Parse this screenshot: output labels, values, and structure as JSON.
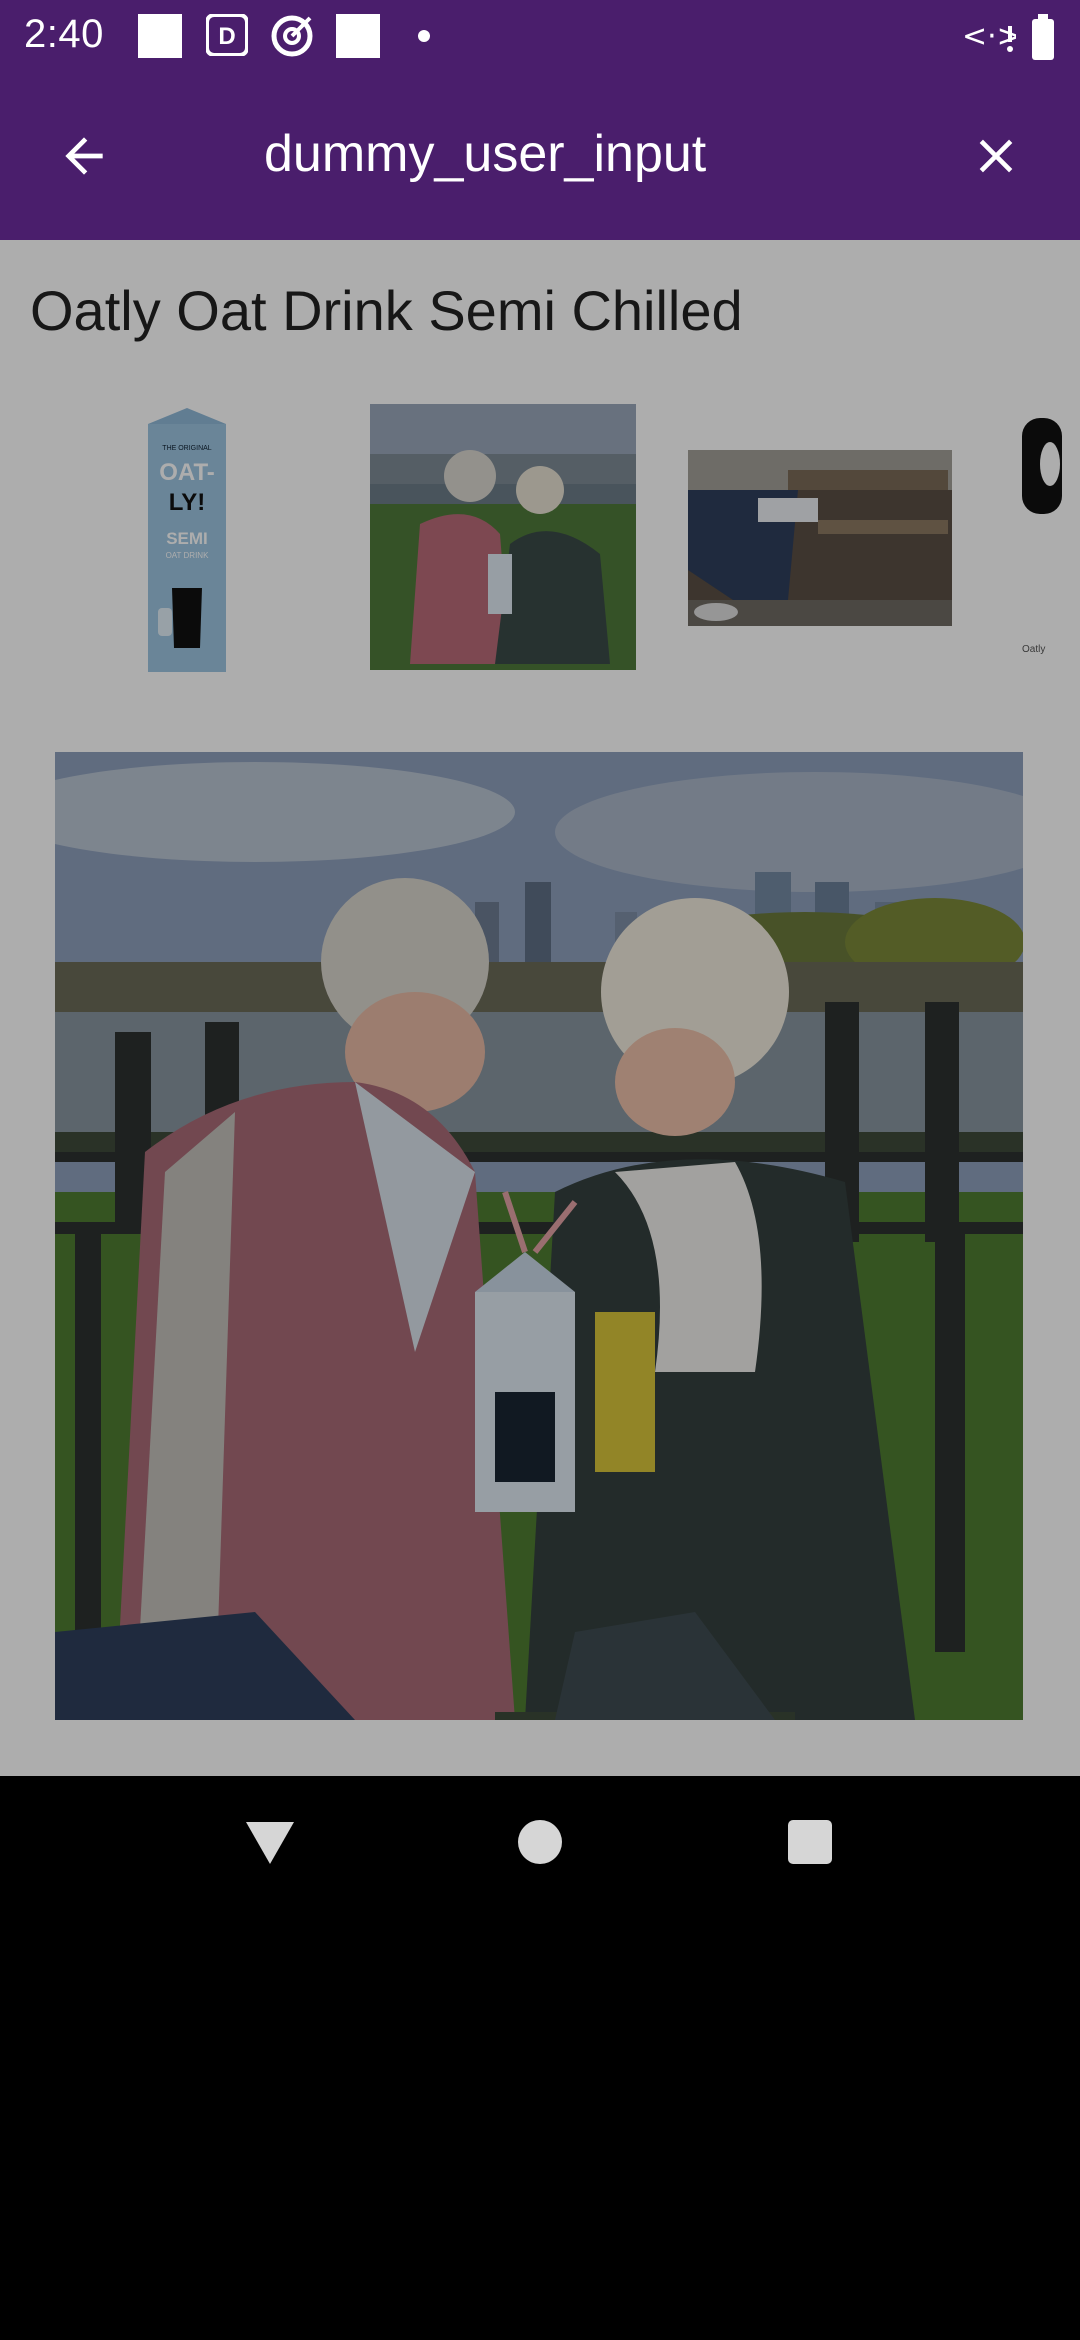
{
  "status_bar": {
    "time": "2:40",
    "left_icons": [
      "square-notification-icon",
      "news-app-icon",
      "target-app-icon",
      "square-notification-icon",
      "dot-icon"
    ],
    "right_icons": [
      "data-transfer-icon",
      "battery-icon"
    ]
  },
  "app_bar": {
    "search_text": "dummy_user_input",
    "background": "#4a1e6c",
    "back_icon": "arrow-back-icon",
    "close_icon": "close-icon"
  },
  "product": {
    "title": "Oatly Oat Drink Semi Chilled",
    "thumbnails": [
      {
        "name": "thumbnail-carton",
        "carton_text": [
          "THE ORIGINAL",
          "OAT-",
          "LY!",
          "SEMI",
          "OAT DRINK"
        ]
      },
      {
        "name": "thumbnail-couple"
      },
      {
        "name": "thumbnail-bench"
      },
      {
        "name": "thumbnail-partial"
      }
    ],
    "thumbnail_caption": "Oatly"
  },
  "nav_bar": {
    "icons": [
      "back-triangle-icon",
      "home-circle-icon",
      "recents-square-icon"
    ]
  }
}
